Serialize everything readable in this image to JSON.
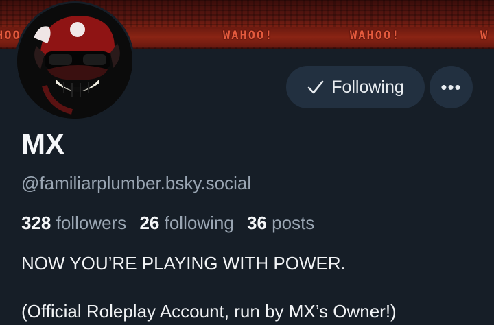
{
  "banner": {
    "texts": [
      "HOO!",
      "WAHOO!",
      "WAHOO!",
      "W"
    ]
  },
  "profile": {
    "display_name": "MX",
    "handle": "@familiarplumber.bsky.social",
    "followers_count": "328",
    "followers_label": "followers",
    "following_count": "26",
    "following_label": "following",
    "posts_count": "36",
    "posts_label": "posts",
    "bio_line1": "NOW YOU’RE PLAYING WITH POWER.",
    "bio_line2": "(Official Roleplay Account, run by MX’s Owner!)"
  },
  "actions": {
    "follow_label": "Following",
    "more_label": "•••"
  },
  "icons": {
    "follow": "check-icon",
    "more": "ellipsis-icon"
  },
  "colors": {
    "background": "#161e27",
    "button_bg": "#223040",
    "muted_text": "#9aa6b3",
    "banner_red": "#7a1f12"
  }
}
